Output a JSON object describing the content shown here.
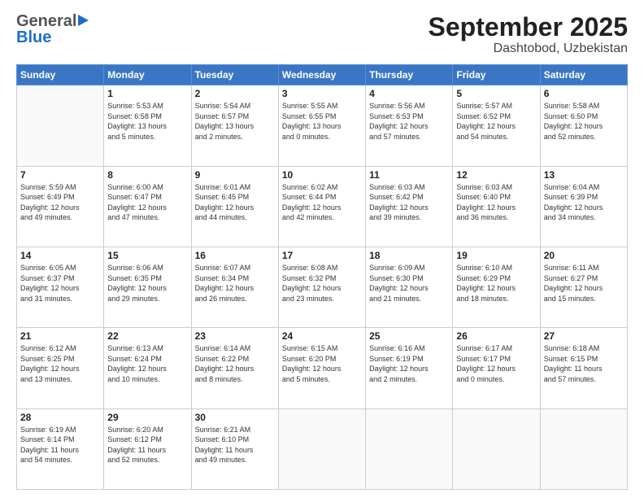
{
  "header": {
    "title": "September 2025",
    "subtitle": "Dashtobod, Uzbekistan",
    "logo_general": "General",
    "logo_blue": "Blue"
  },
  "days_of_week": [
    "Sunday",
    "Monday",
    "Tuesday",
    "Wednesday",
    "Thursday",
    "Friday",
    "Saturday"
  ],
  "weeks": [
    [
      {
        "day": "",
        "info": ""
      },
      {
        "day": "1",
        "info": "Sunrise: 5:53 AM\nSunset: 6:58 PM\nDaylight: 13 hours\nand 5 minutes."
      },
      {
        "day": "2",
        "info": "Sunrise: 5:54 AM\nSunset: 6:57 PM\nDaylight: 13 hours\nand 2 minutes."
      },
      {
        "day": "3",
        "info": "Sunrise: 5:55 AM\nSunset: 6:55 PM\nDaylight: 13 hours\nand 0 minutes."
      },
      {
        "day": "4",
        "info": "Sunrise: 5:56 AM\nSunset: 6:53 PM\nDaylight: 12 hours\nand 57 minutes."
      },
      {
        "day": "5",
        "info": "Sunrise: 5:57 AM\nSunset: 6:52 PM\nDaylight: 12 hours\nand 54 minutes."
      },
      {
        "day": "6",
        "info": "Sunrise: 5:58 AM\nSunset: 6:50 PM\nDaylight: 12 hours\nand 52 minutes."
      }
    ],
    [
      {
        "day": "7",
        "info": "Sunrise: 5:59 AM\nSunset: 6:49 PM\nDaylight: 12 hours\nand 49 minutes."
      },
      {
        "day": "8",
        "info": "Sunrise: 6:00 AM\nSunset: 6:47 PM\nDaylight: 12 hours\nand 47 minutes."
      },
      {
        "day": "9",
        "info": "Sunrise: 6:01 AM\nSunset: 6:45 PM\nDaylight: 12 hours\nand 44 minutes."
      },
      {
        "day": "10",
        "info": "Sunrise: 6:02 AM\nSunset: 6:44 PM\nDaylight: 12 hours\nand 42 minutes."
      },
      {
        "day": "11",
        "info": "Sunrise: 6:03 AM\nSunset: 6:42 PM\nDaylight: 12 hours\nand 39 minutes."
      },
      {
        "day": "12",
        "info": "Sunrise: 6:03 AM\nSunset: 6:40 PM\nDaylight: 12 hours\nand 36 minutes."
      },
      {
        "day": "13",
        "info": "Sunrise: 6:04 AM\nSunset: 6:39 PM\nDaylight: 12 hours\nand 34 minutes."
      }
    ],
    [
      {
        "day": "14",
        "info": "Sunrise: 6:05 AM\nSunset: 6:37 PM\nDaylight: 12 hours\nand 31 minutes."
      },
      {
        "day": "15",
        "info": "Sunrise: 6:06 AM\nSunset: 6:35 PM\nDaylight: 12 hours\nand 29 minutes."
      },
      {
        "day": "16",
        "info": "Sunrise: 6:07 AM\nSunset: 6:34 PM\nDaylight: 12 hours\nand 26 minutes."
      },
      {
        "day": "17",
        "info": "Sunrise: 6:08 AM\nSunset: 6:32 PM\nDaylight: 12 hours\nand 23 minutes."
      },
      {
        "day": "18",
        "info": "Sunrise: 6:09 AM\nSunset: 6:30 PM\nDaylight: 12 hours\nand 21 minutes."
      },
      {
        "day": "19",
        "info": "Sunrise: 6:10 AM\nSunset: 6:29 PM\nDaylight: 12 hours\nand 18 minutes."
      },
      {
        "day": "20",
        "info": "Sunrise: 6:11 AM\nSunset: 6:27 PM\nDaylight: 12 hours\nand 15 minutes."
      }
    ],
    [
      {
        "day": "21",
        "info": "Sunrise: 6:12 AM\nSunset: 6:25 PM\nDaylight: 12 hours\nand 13 minutes."
      },
      {
        "day": "22",
        "info": "Sunrise: 6:13 AM\nSunset: 6:24 PM\nDaylight: 12 hours\nand 10 minutes."
      },
      {
        "day": "23",
        "info": "Sunrise: 6:14 AM\nSunset: 6:22 PM\nDaylight: 12 hours\nand 8 minutes."
      },
      {
        "day": "24",
        "info": "Sunrise: 6:15 AM\nSunset: 6:20 PM\nDaylight: 12 hours\nand 5 minutes."
      },
      {
        "day": "25",
        "info": "Sunrise: 6:16 AM\nSunset: 6:19 PM\nDaylight: 12 hours\nand 2 minutes."
      },
      {
        "day": "26",
        "info": "Sunrise: 6:17 AM\nSunset: 6:17 PM\nDaylight: 12 hours\nand 0 minutes."
      },
      {
        "day": "27",
        "info": "Sunrise: 6:18 AM\nSunset: 6:15 PM\nDaylight: 11 hours\nand 57 minutes."
      }
    ],
    [
      {
        "day": "28",
        "info": "Sunrise: 6:19 AM\nSunset: 6:14 PM\nDaylight: 11 hours\nand 54 minutes."
      },
      {
        "day": "29",
        "info": "Sunrise: 6:20 AM\nSunset: 6:12 PM\nDaylight: 11 hours\nand 52 minutes."
      },
      {
        "day": "30",
        "info": "Sunrise: 6:21 AM\nSunset: 6:10 PM\nDaylight: 11 hours\nand 49 minutes."
      },
      {
        "day": "",
        "info": ""
      },
      {
        "day": "",
        "info": ""
      },
      {
        "day": "",
        "info": ""
      },
      {
        "day": "",
        "info": ""
      }
    ]
  ]
}
